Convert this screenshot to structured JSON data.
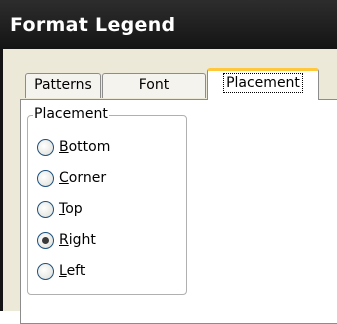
{
  "window": {
    "title": "Format Legend"
  },
  "tabs": [
    {
      "label": "Patterns",
      "active": false
    },
    {
      "label": "Font",
      "active": false
    },
    {
      "label": "Placement",
      "active": true
    }
  ],
  "placement_group": {
    "label": "Placement",
    "options": [
      {
        "mnemonic": "B",
        "rest": "ottom",
        "checked": false
      },
      {
        "mnemonic": "C",
        "rest": "orner",
        "checked": false
      },
      {
        "mnemonic": "T",
        "rest": "op",
        "checked": false
      },
      {
        "mnemonic": "R",
        "rest": "ight",
        "checked": true
      },
      {
        "mnemonic": "L",
        "rest": "eft",
        "checked": false
      }
    ]
  }
}
